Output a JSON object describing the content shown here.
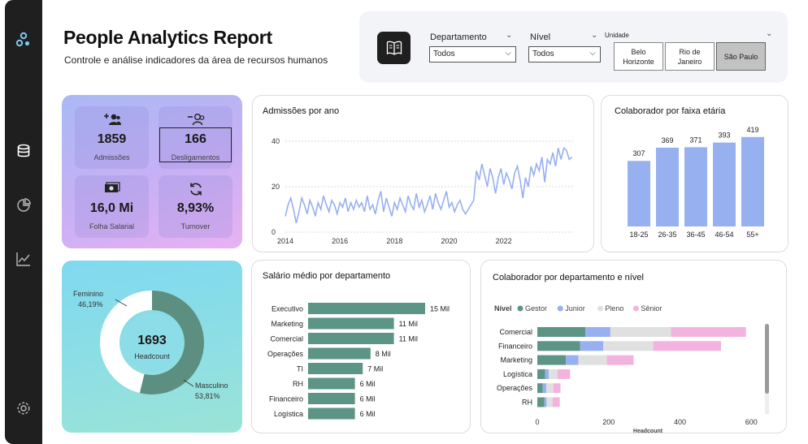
{
  "header": {
    "title": "People Analytics Report",
    "subtitle": "Controle e análise indicadores da área de recursos humanos"
  },
  "rail": {
    "icons": [
      "logo-icon",
      "database-icon",
      "pie-chart-icon",
      "line-chart-icon",
      "settings-icon"
    ]
  },
  "filters": {
    "departamento": {
      "label": "Departamento",
      "value": "Todos"
    },
    "nivel": {
      "label": "Nível",
      "value": "Todos"
    },
    "unidade": {
      "label": "Unidade",
      "options": [
        {
          "label": "Belo Horizonte",
          "line1": "Belo",
          "line2": "Horizonte",
          "selected": false
        },
        {
          "label": "Rio de Janeiro",
          "line1": "Rio de",
          "line2": "Janeiro",
          "selected": false
        },
        {
          "label": "São Paulo",
          "line1": "São Paulo",
          "line2": "",
          "selected": true
        }
      ]
    }
  },
  "kpis": [
    {
      "value": "1859",
      "label": "Admissões",
      "icon": "user-add-icon"
    },
    {
      "value": "166",
      "label": "Desligamentos",
      "icon": "user-remove-icon"
    },
    {
      "value": "16,0 Mi",
      "label": "Folha Salarial",
      "icon": "money-icon"
    },
    {
      "value": "8,93%",
      "label": "Turnover",
      "icon": "refresh-icon"
    }
  ],
  "donut": {
    "center_value": "1693",
    "center_label": "Headcount",
    "segments": [
      {
        "name": "Feminino",
        "pct_label": "46,19%",
        "value": 46.19,
        "color": "#ffffff"
      },
      {
        "name": "Masculino",
        "pct_label": "53,81%",
        "value": 53.81,
        "color": "#5c8f80"
      }
    ]
  },
  "colors": {
    "accent_blue": "#97b0f0",
    "accent_green": "#5c9486",
    "gestor": "#5c9486",
    "junior": "#97b0f0",
    "pleno": "#e0e0e0",
    "senior": "#f3b3df"
  },
  "chart_data": [
    {
      "type": "line",
      "title": "Admissões por ano",
      "x_tick_labels": [
        "2014",
        "2016",
        "2018",
        "2020",
        "2022"
      ],
      "y_tick_labels": [
        "0",
        "20",
        "40"
      ],
      "ylim": [
        0,
        40
      ],
      "xlim": [
        2014,
        2024.6
      ],
      "series": [
        {
          "color": "#97b0f0",
          "points": [
            [
              2014.0,
              7
            ],
            [
              2014.1,
              12
            ],
            [
              2014.2,
              15
            ],
            [
              2014.3,
              10
            ],
            [
              2014.4,
              4
            ],
            [
              2014.5,
              9
            ],
            [
              2014.6,
              15
            ],
            [
              2014.7,
              12
            ],
            [
              2014.8,
              8
            ],
            [
              2014.9,
              14
            ],
            [
              2015.0,
              11
            ],
            [
              2015.1,
              7
            ],
            [
              2015.2,
              13
            ],
            [
              2015.3,
              10
            ],
            [
              2015.4,
              16
            ],
            [
              2015.5,
              12
            ],
            [
              2015.6,
              9
            ],
            [
              2015.7,
              14
            ],
            [
              2015.8,
              12
            ],
            [
              2015.9,
              8
            ],
            [
              2016.0,
              13
            ],
            [
              2016.1,
              11
            ],
            [
              2016.2,
              15
            ],
            [
              2016.3,
              9
            ],
            [
              2016.4,
              13
            ],
            [
              2016.5,
              10
            ],
            [
              2016.6,
              14
            ],
            [
              2016.7,
              11
            ],
            [
              2016.8,
              13
            ],
            [
              2016.9,
              9
            ],
            [
              2017.0,
              16
            ],
            [
              2017.1,
              10
            ],
            [
              2017.2,
              12
            ],
            [
              2017.3,
              8
            ],
            [
              2017.4,
              14
            ],
            [
              2017.5,
              18
            ],
            [
              2017.6,
              9
            ],
            [
              2017.7,
              15
            ],
            [
              2017.8,
              11
            ],
            [
              2017.9,
              7
            ],
            [
              2018.0,
              13
            ],
            [
              2018.1,
              10
            ],
            [
              2018.2,
              15
            ],
            [
              2018.3,
              12
            ],
            [
              2018.4,
              9
            ],
            [
              2018.5,
              16
            ],
            [
              2018.6,
              12
            ],
            [
              2018.7,
              10
            ],
            [
              2018.8,
              17
            ],
            [
              2018.9,
              11
            ],
            [
              2019.0,
              14
            ],
            [
              2019.1,
              9
            ],
            [
              2019.2,
              12
            ],
            [
              2019.3,
              16
            ],
            [
              2019.4,
              10
            ],
            [
              2019.5,
              17
            ],
            [
              2019.6,
              13
            ],
            [
              2019.7,
              10
            ],
            [
              2019.8,
              14
            ],
            [
              2019.9,
              18
            ],
            [
              2020.0,
              11
            ],
            [
              2020.1,
              13
            ],
            [
              2020.2,
              9
            ],
            [
              2020.3,
              12
            ],
            [
              2020.4,
              14
            ],
            [
              2020.5,
              10
            ],
            [
              2020.6,
              8
            ],
            [
              2020.7,
              10
            ],
            [
              2020.8,
              12
            ],
            [
              2020.9,
              14
            ],
            [
              2021.0,
              27
            ],
            [
              2021.1,
              23
            ],
            [
              2021.2,
              30
            ],
            [
              2021.3,
              25
            ],
            [
              2021.4,
              20
            ],
            [
              2021.5,
              28
            ],
            [
              2021.6,
              24
            ],
            [
              2021.7,
              17
            ],
            [
              2021.8,
              24
            ],
            [
              2021.9,
              28
            ],
            [
              2022.0,
              21
            ],
            [
              2022.1,
              26
            ],
            [
              2022.2,
              23
            ],
            [
              2022.3,
              19
            ],
            [
              2022.4,
              26
            ],
            [
              2022.5,
              29
            ],
            [
              2022.6,
              23
            ],
            [
              2022.7,
              15
            ],
            [
              2022.8,
              24
            ],
            [
              2022.9,
              20
            ],
            [
              2023.0,
              29
            ],
            [
              2023.1,
              25
            ],
            [
              2023.2,
              30
            ],
            [
              2023.3,
              27
            ],
            [
              2023.4,
              33
            ],
            [
              2023.5,
              22
            ],
            [
              2023.6,
              32
            ],
            [
              2023.7,
              30
            ],
            [
              2023.8,
              35
            ],
            [
              2023.9,
              29
            ],
            [
              2024.0,
              37
            ],
            [
              2024.1,
              32
            ],
            [
              2024.2,
              37
            ],
            [
              2024.3,
              36
            ],
            [
              2024.4,
              32
            ],
            [
              2024.5,
              33
            ]
          ]
        }
      ]
    },
    {
      "type": "bar",
      "title": "Colaborador por faixa etária",
      "categories": [
        "18-25",
        "26-35",
        "36-45",
        "46-54",
        "55+"
      ],
      "values": [
        307,
        369,
        371,
        393,
        419
      ],
      "ylim": [
        0,
        460
      ]
    },
    {
      "type": "bar",
      "orientation": "horizontal",
      "title": "Salário médio por departamento",
      "categories": [
        "Executivo",
        "Marketing",
        "Comercial",
        "Operações",
        "TI",
        "RH",
        "Financeiro",
        "Logística"
      ],
      "values": [
        15,
        11,
        11,
        8,
        7,
        6,
        6,
        6
      ],
      "value_labels": [
        "15 Mil",
        "11 Mil",
        "11 Mil",
        "8 Mil",
        "7 Mil",
        "6 Mil",
        "6 Mil",
        "6 Mil"
      ],
      "unit": "Mil"
    },
    {
      "type": "bar",
      "orientation": "horizontal",
      "stacked": true,
      "title": "Colaborador por departamento e nível",
      "legend_title": "Nível",
      "legend_position": "top-left",
      "categories": [
        "Comercial",
        "Financeiro",
        "Marketing",
        "Logística",
        "Operações",
        "RH"
      ],
      "x_tick_labels": [
        "0",
        "200",
        "400",
        "600"
      ],
      "xlim": [
        0,
        620
      ],
      "xlabel": "Headcount",
      "series": [
        {
          "name": "Gestor",
          "values": [
            135,
            120,
            80,
            22,
            15,
            20
          ]
        },
        {
          "name": "Junior",
          "values": [
            70,
            65,
            35,
            10,
            10,
            6
          ]
        },
        {
          "name": "Pleno",
          "values": [
            170,
            140,
            80,
            25,
            20,
            17
          ]
        },
        {
          "name": "Sênior",
          "values": [
            210,
            190,
            75,
            35,
            20,
            20
          ]
        }
      ]
    }
  ]
}
